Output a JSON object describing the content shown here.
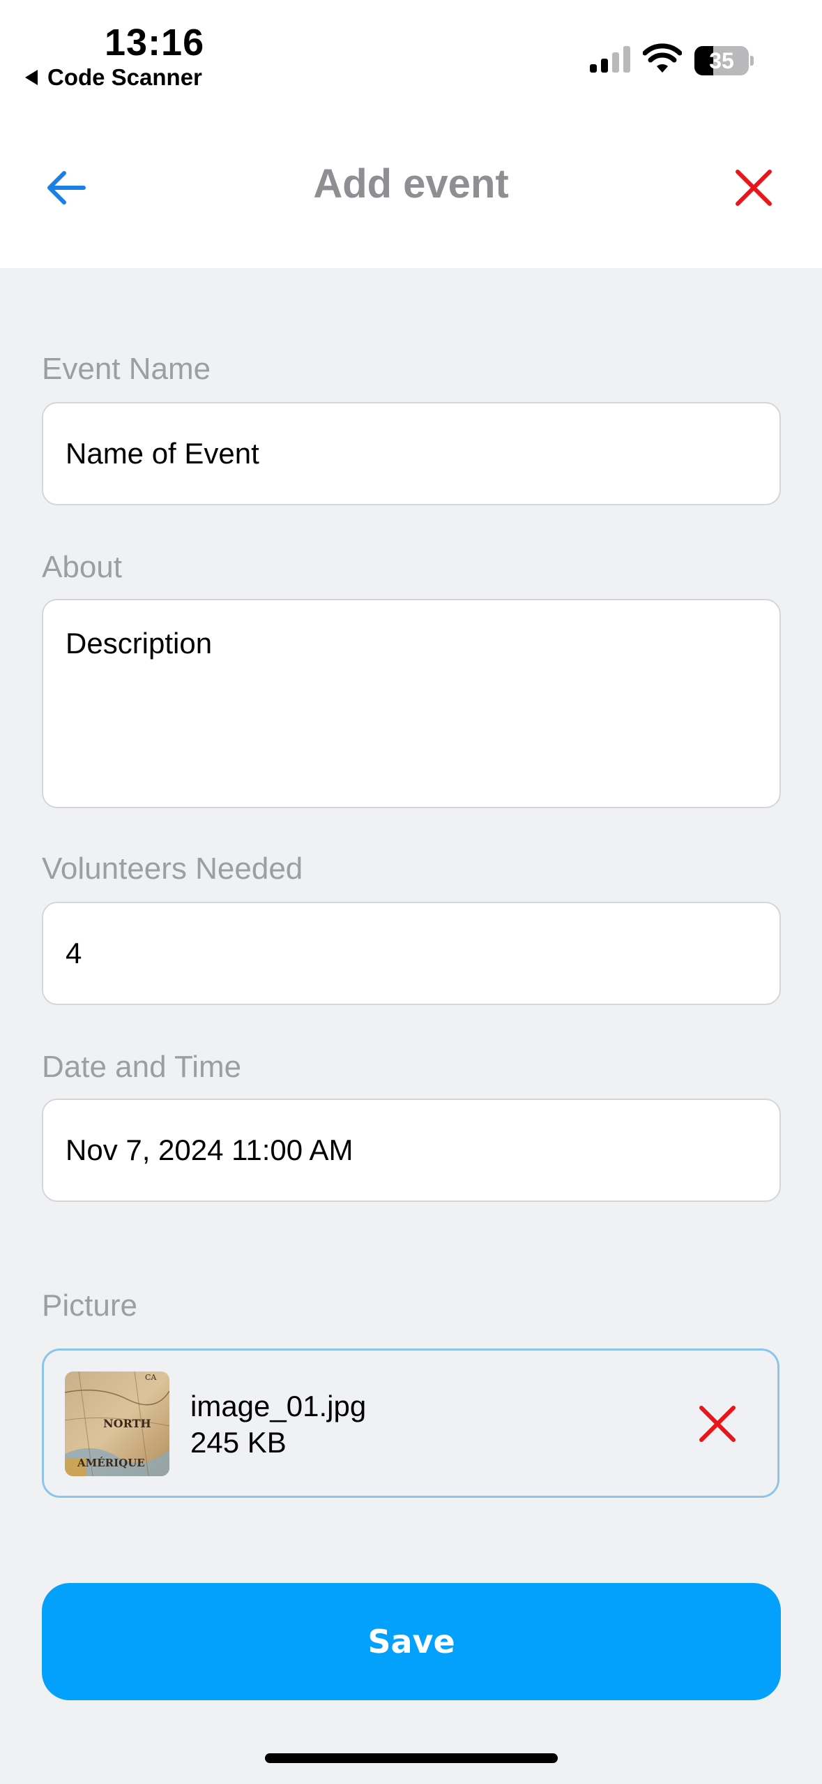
{
  "status_bar": {
    "time": "13:16",
    "back_app_label": "Code Scanner",
    "battery_percent": "35",
    "battery_level": 0.35
  },
  "nav": {
    "title": "Add event",
    "back_icon": "arrow-left-icon",
    "close_icon": "close-icon",
    "back_color": "#1a7fe6",
    "close_color": "#e8161b"
  },
  "form": {
    "event_name": {
      "label": "Event Name",
      "value": "Name of Event"
    },
    "about": {
      "label": "About",
      "value": "Description"
    },
    "volunteers": {
      "label": "Volunteers Needed",
      "value": "4"
    },
    "date_time": {
      "label": "Date and Time",
      "value": "Nov 7, 2024 11:00 AM"
    },
    "picture": {
      "label": "Picture",
      "file_name": "image_01.jpg",
      "file_size": "245 KB",
      "thumb_text_1": "NORTH",
      "thumb_text_2": "AMÉRIQUE",
      "thumb_text_3": "CA"
    },
    "save_label": "Save"
  },
  "colors": {
    "accent": "#03a1fc",
    "danger": "#e8161b",
    "label_gray": "#9b9ea3",
    "background": "#f0f1f3"
  }
}
